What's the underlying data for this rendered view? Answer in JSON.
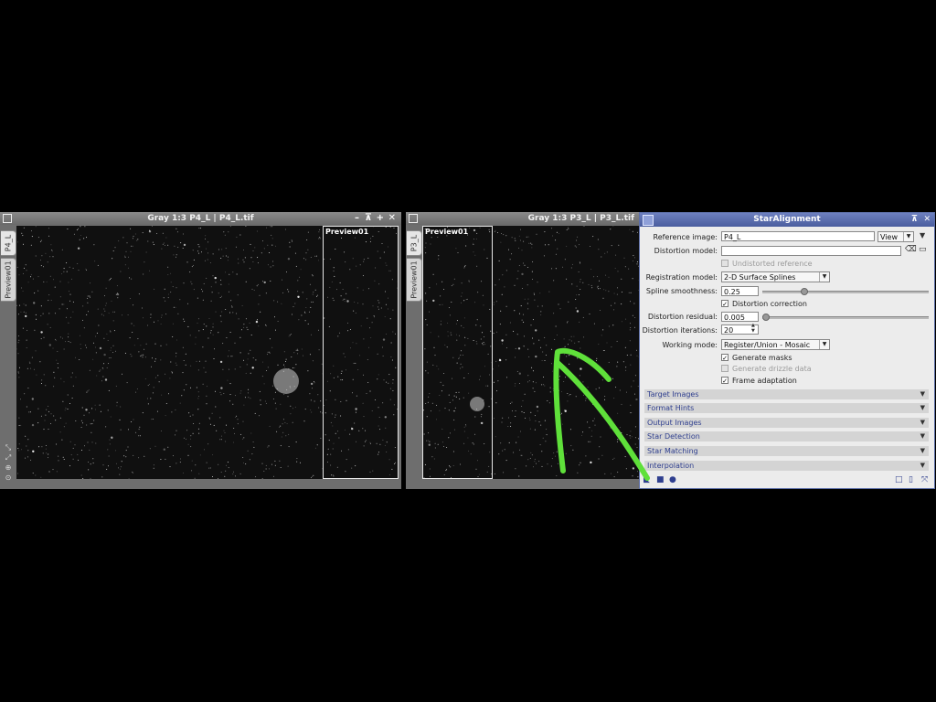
{
  "left_window": {
    "title": "Gray 1:3 P4_L | P4_L.tif",
    "tabs": [
      "P4_L",
      "Preview01"
    ],
    "preview_label": "Preview01"
  },
  "right_window": {
    "title": "Gray 1:3 P3_L | P3_L.tif",
    "tabs": [
      "P3_L",
      "Preview01"
    ],
    "preview_label": "Preview01"
  },
  "dialog": {
    "title": "StarAlignment",
    "reference_image_label": "Reference image:",
    "reference_image_value": "P4_L",
    "view_option": "View",
    "distortion_model_label": "Distortion model:",
    "distortion_model_value": "",
    "undistorted_reference_label": "Undistorted reference",
    "registration_model_label": "Registration model:",
    "registration_model_value": "2-D Surface Splines",
    "spline_smoothness_label": "Spline smoothness:",
    "spline_smoothness_value": "0.25",
    "distortion_correction_label": "Distortion correction",
    "distortion_residual_label": "Distortion residual:",
    "distortion_residual_value": "0.005",
    "distortion_iterations_label": "Distortion iterations:",
    "distortion_iterations_value": "20",
    "working_mode_label": "Working mode:",
    "working_mode_value": "Register/Union - Mosaic",
    "generate_masks_label": "Generate masks",
    "generate_drizzle_label": "Generate drizzle data",
    "frame_adaptation_label": "Frame adaptation",
    "sections": [
      "Target Images",
      "Format Hints",
      "Output Images",
      "Star Detection",
      "Star Matching",
      "Interpolation"
    ]
  },
  "colors": {
    "arrow": "#5fe03a",
    "dialog_title": "#4a5d9e",
    "section_text": "#2f3f8f"
  }
}
